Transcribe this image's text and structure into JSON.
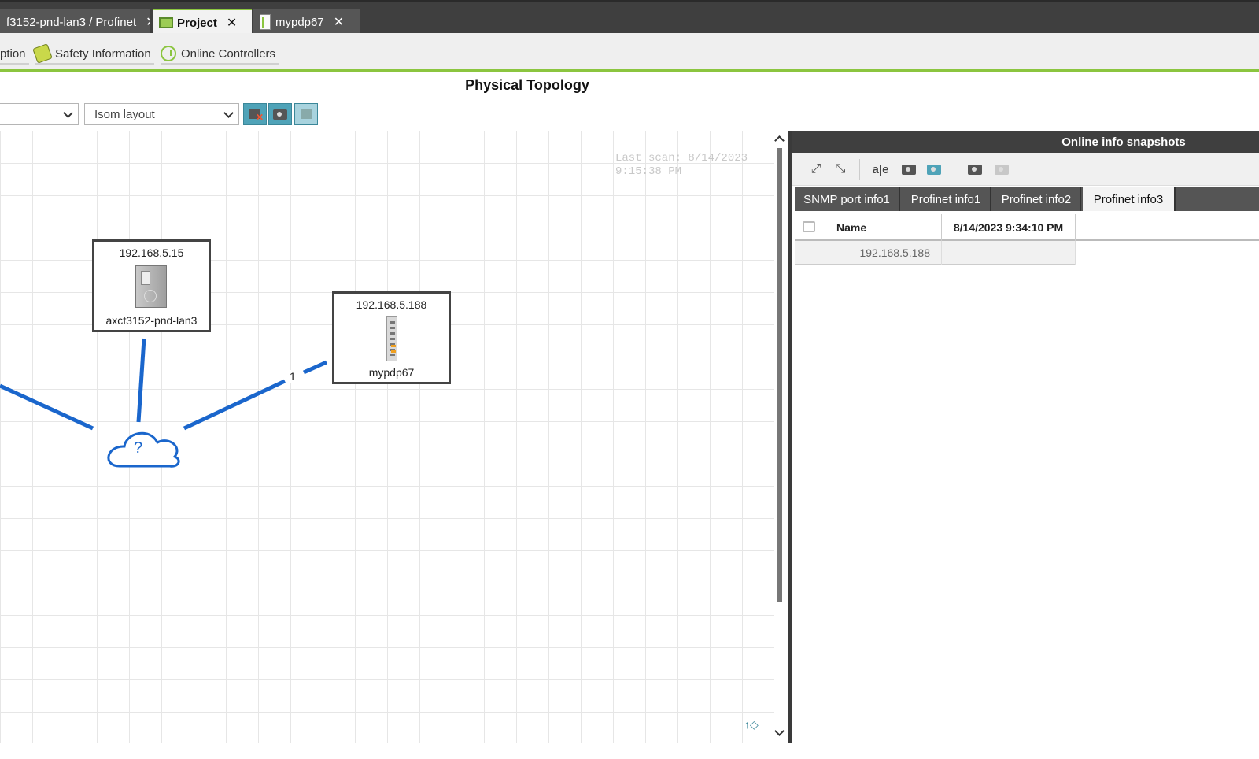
{
  "tabs": [
    {
      "label": "f3152-pnd-lan3 / Profinet",
      "close": "✕"
    },
    {
      "label": "Project",
      "close": "✕"
    },
    {
      "label": "mypdp67",
      "close": "✕"
    }
  ],
  "toolbar": {
    "description_label": "ption",
    "safety_label": "Safety Information",
    "online_controllers_label": "Online Controllers"
  },
  "page_title": "Physical Topology",
  "filters": {
    "first_select_value": "",
    "layout_select_value": "Isom layout"
  },
  "canvas": {
    "last_scan_line1": "Last scan: 8/14/2023",
    "last_scan_line2": "9:15:38 PM",
    "devices": [
      {
        "ip": "192.168.5.15",
        "name": "axcf3152-pnd-lan3"
      },
      {
        "ip": "192.168.5.188",
        "name": "mypdp67"
      }
    ],
    "cloud_label": "?",
    "link_label": "1"
  },
  "panel": {
    "title": "Online info snapshots",
    "tabs": [
      "SNMP port info1",
      "Profinet info1",
      "Profinet info2",
      "Profinet info3"
    ],
    "active_tab": "Profinet info3",
    "columns": [
      "Name",
      "8/14/2023 9:34:10 PM"
    ],
    "rows": [
      {
        "name": "192.168.5.188",
        "value": ""
      }
    ]
  }
}
